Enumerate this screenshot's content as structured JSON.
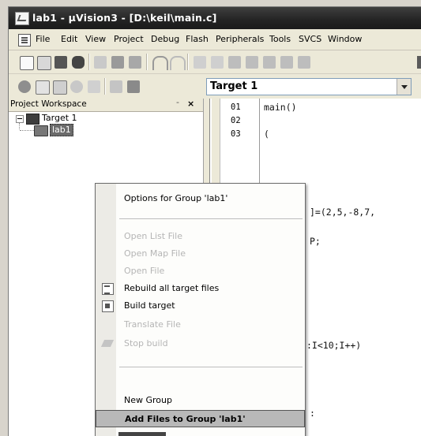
{
  "window": {
    "title": "lab1 - µVision3 - [D:\\keil\\main.c]"
  },
  "menubar": {
    "items": [
      "File",
      "Edit",
      "View",
      "Project",
      "Debug",
      "Flash",
      "Peripherals",
      "Tools",
      "SVCS",
      "Window"
    ]
  },
  "toolbar": {
    "target_value": "Target 1"
  },
  "workspace": {
    "title": "Project Workspace",
    "pin": "- ",
    "close": "×",
    "tree": {
      "target_label": "Target 1",
      "group_label": "lab1"
    }
  },
  "editor": {
    "line_numbers": [
      "01",
      "02",
      "03"
    ],
    "code_lines": {
      "line1": "main()",
      "line3": "(",
      "frag_array": "]=(2,5,-8,7,",
      "frag_p": "P;",
      "frag_loop": ":I<10;I++)",
      "frag_bottom": ":"
    }
  },
  "context_menu": {
    "options_group": "Options for Group 'lab1'",
    "open_list": "Open List File",
    "open_map": "Open Map File",
    "open_file": "Open File",
    "rebuild_all": "Rebuild all target files",
    "build_target": "Build target",
    "translate_file": "Translate File",
    "stop_build": "Stop build",
    "new_group": "New Group",
    "add_files": "Add Files to Group 'lab1'"
  }
}
